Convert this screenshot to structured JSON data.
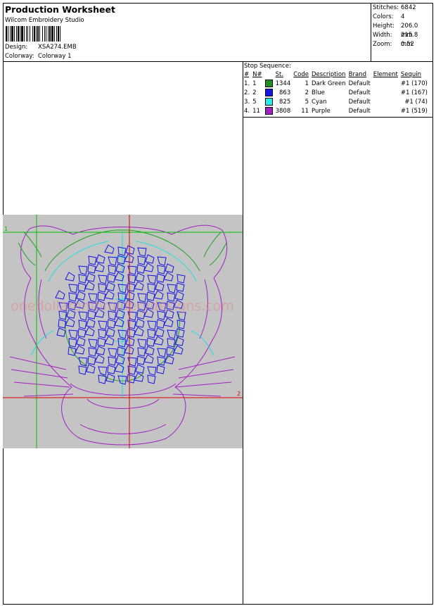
{
  "header": {
    "title": "Production Worksheet",
    "software": "Wilcom  Embroidery Studio",
    "design_label": "Design:",
    "design_value": "XSA274.EMB",
    "colorway_label": "Colorway:",
    "colorway_value": "Colorway 1"
  },
  "stats": [
    {
      "label": "Stitches:",
      "value": "6842"
    },
    {
      "label": "Colors:",
      "value": "4"
    },
    {
      "label": "Height:",
      "value": "206.0 mm"
    },
    {
      "label": "Width:",
      "value": "215.8 mm"
    },
    {
      "label": "Zoom:",
      "value": "0.52"
    }
  ],
  "stop_sequence": {
    "title": "Stop Sequence:",
    "columns": [
      "#",
      "N#",
      "St.",
      "Code",
      "Description",
      "Brand",
      "Element",
      "Sequin"
    ],
    "rows": [
      {
        "num": "1.",
        "n": "1",
        "color": "#1f8f1f",
        "st": "1344",
        "code": "1",
        "desc": "Dark Green",
        "brand": "Default",
        "element": "",
        "sequin": "#1 (170)"
      },
      {
        "num": "2.",
        "n": "2",
        "color": "#1414e6",
        "st": "863",
        "code": "2",
        "desc": "Blue",
        "brand": "Default",
        "element": "",
        "sequin": "#1 (167)"
      },
      {
        "num": "3.",
        "n": "5",
        "color": "#22eeee",
        "st": "825",
        "code": "5",
        "desc": "Cyan",
        "brand": "Default",
        "element": "",
        "sequin": "#1 (74)"
      },
      {
        "num": "4.",
        "n": "11",
        "color": "#a31fc4",
        "st": "3808",
        "code": "11",
        "desc": "Purple",
        "brand": "Default",
        "element": "",
        "sequin": "#1 (519)"
      }
    ]
  },
  "design_preview": {
    "background": "#c4c4c4",
    "guide_markers": [
      "1",
      "2"
    ],
    "watermark": "onedollarembroiderydesigns.com",
    "colors": {
      "green": "#1f9f1f",
      "blue": "#1414e6",
      "cyan": "#22dddd",
      "purple": "#a31fc4",
      "guide_red": "#e00000",
      "guide_green": "#00c000"
    }
  }
}
